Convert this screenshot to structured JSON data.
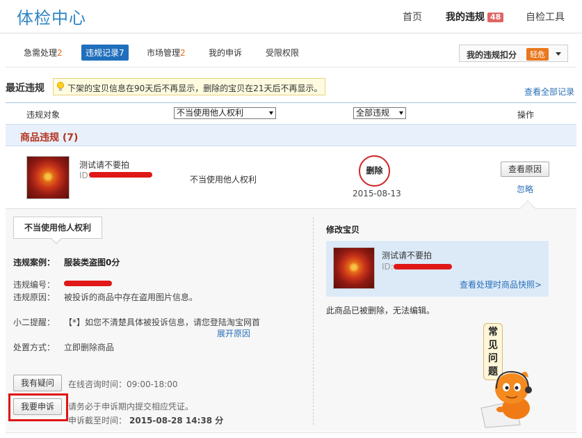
{
  "header": {
    "logo": "体检中心",
    "nav_home": "首页",
    "nav_violations": "我的违规",
    "nav_violations_badge": "48",
    "nav_selfcheck": "自检工具"
  },
  "tabs": [
    {
      "label": "急需处理",
      "num": "2"
    },
    {
      "label": "违规记录",
      "num": "7"
    },
    {
      "label": "市场管理",
      "num": "2"
    },
    {
      "label": "我的申诉",
      "num": ""
    },
    {
      "label": "受限权限",
      "num": ""
    }
  ],
  "deduct": {
    "label": "我的违规扣分",
    "level": "轻危"
  },
  "recent": {
    "title": "最近违规",
    "notice": "下架的宝贝信息在90天后不再显示，删除的宝贝在21天后不再显示。",
    "view_all": "查看全部记录"
  },
  "filters": {
    "col_object": "违规对象",
    "select_reason": "不当使用他人权利",
    "select_all": "全部违规",
    "col_action": "操作"
  },
  "section": {
    "title": "商品违规 (7)"
  },
  "item": {
    "name": "测试请不要拍",
    "id_prefix": "ID:",
    "reason": "不当使用他人权利",
    "stamp": "删除",
    "date": "2015-08-13",
    "view_reason": "查看原因",
    "ignore": "忽略"
  },
  "detail": {
    "tag": "不当使用他人权利",
    "case_label": "违规案例：",
    "case_value": "服装类盗图0分",
    "no_label": "违规编号：",
    "reason_label": "违规原因：",
    "reason_value": "被投诉的商品中存在盗用图片信息。",
    "tip_label": "小二提醒：",
    "tip_value": "【*】如您不清楚具体被投诉信息，请您登陆淘宝网首",
    "expand": "展开原因",
    "method_label": "处置方式：",
    "method_value": "立即删除商品",
    "question_btn": "我有疑问",
    "consult": "在线咨询时间：09:00-18:00",
    "appeal_btn": "我要申诉",
    "appeal_note": "请务必于申诉期内提交相应凭证。",
    "deadline_label": "申诉截至时间：",
    "deadline_value": "2015-08-28 14:38 分"
  },
  "modify": {
    "title": "修改宝贝",
    "name": "测试请不要拍",
    "id_prefix": "ID:",
    "snapshot": "查看处理时商品快照>",
    "deleted_note": "此商品已被删除，无法编辑。"
  },
  "faq": {
    "c1": "常",
    "c2": "见",
    "c3": "问",
    "c4": "题"
  },
  "colors": {
    "brand": "#2f85c4",
    "alert": "#e01414",
    "accent": "#e8771e",
    "link": "#2a6fb7"
  }
}
